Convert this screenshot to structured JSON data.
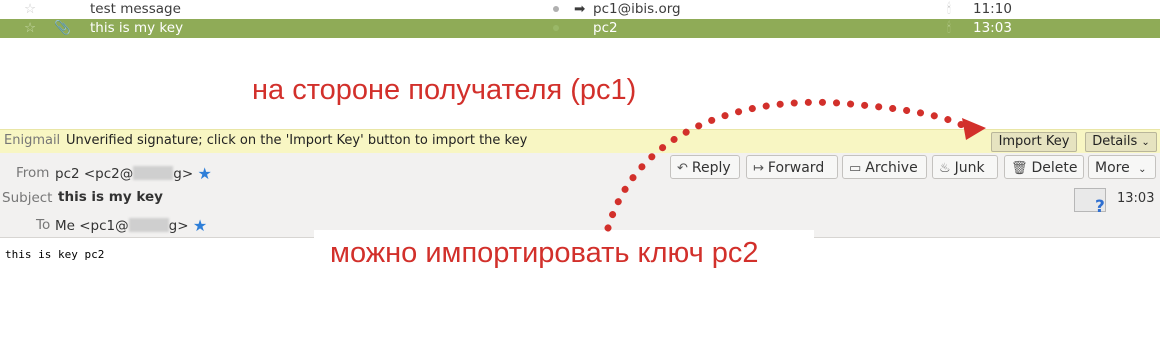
{
  "message_list": [
    {
      "subject": "test message",
      "correspondent": "pc1@ibis.org",
      "time": "11:10",
      "selected": false
    },
    {
      "subject": "this is my key",
      "correspondent": "pc2",
      "time": "13:03",
      "selected": true
    }
  ],
  "enigmail": {
    "label": "Enigmail",
    "message": "Unverified signature; click on the 'Import Key' button to import the key",
    "import_key": "Import Key",
    "details": "Details"
  },
  "header": {
    "from_label": "From",
    "from_name": "pc2 <pc2@",
    "from_tail": "g>",
    "subject_label": "Subject",
    "subject": "this is my key",
    "to_label": "To",
    "to_name": "Me <pc1@",
    "to_tail": "g>",
    "time": "13:03"
  },
  "toolbar": {
    "reply": "Reply",
    "forward": "Forward",
    "archive": "Archive",
    "junk": "Junk",
    "delete": "Delete",
    "more": "More"
  },
  "body": {
    "text": "this is key pc2"
  },
  "annotations": {
    "top": "на стороне получателя (pc1)",
    "bottom": "можно импортировать ключ pc2"
  },
  "colors": {
    "selection": "#8fab57",
    "annotation": "#d2302b",
    "enigmail_bar": "#f8f6c3"
  },
  "icons": [
    "star-icon",
    "attachment-icon",
    "thread-dot-icon",
    "reply-icon",
    "forward-icon",
    "archive-icon",
    "junk-icon",
    "delete-icon",
    "chevron-down-icon",
    "contact-star-icon",
    "signature-status-icon"
  ]
}
